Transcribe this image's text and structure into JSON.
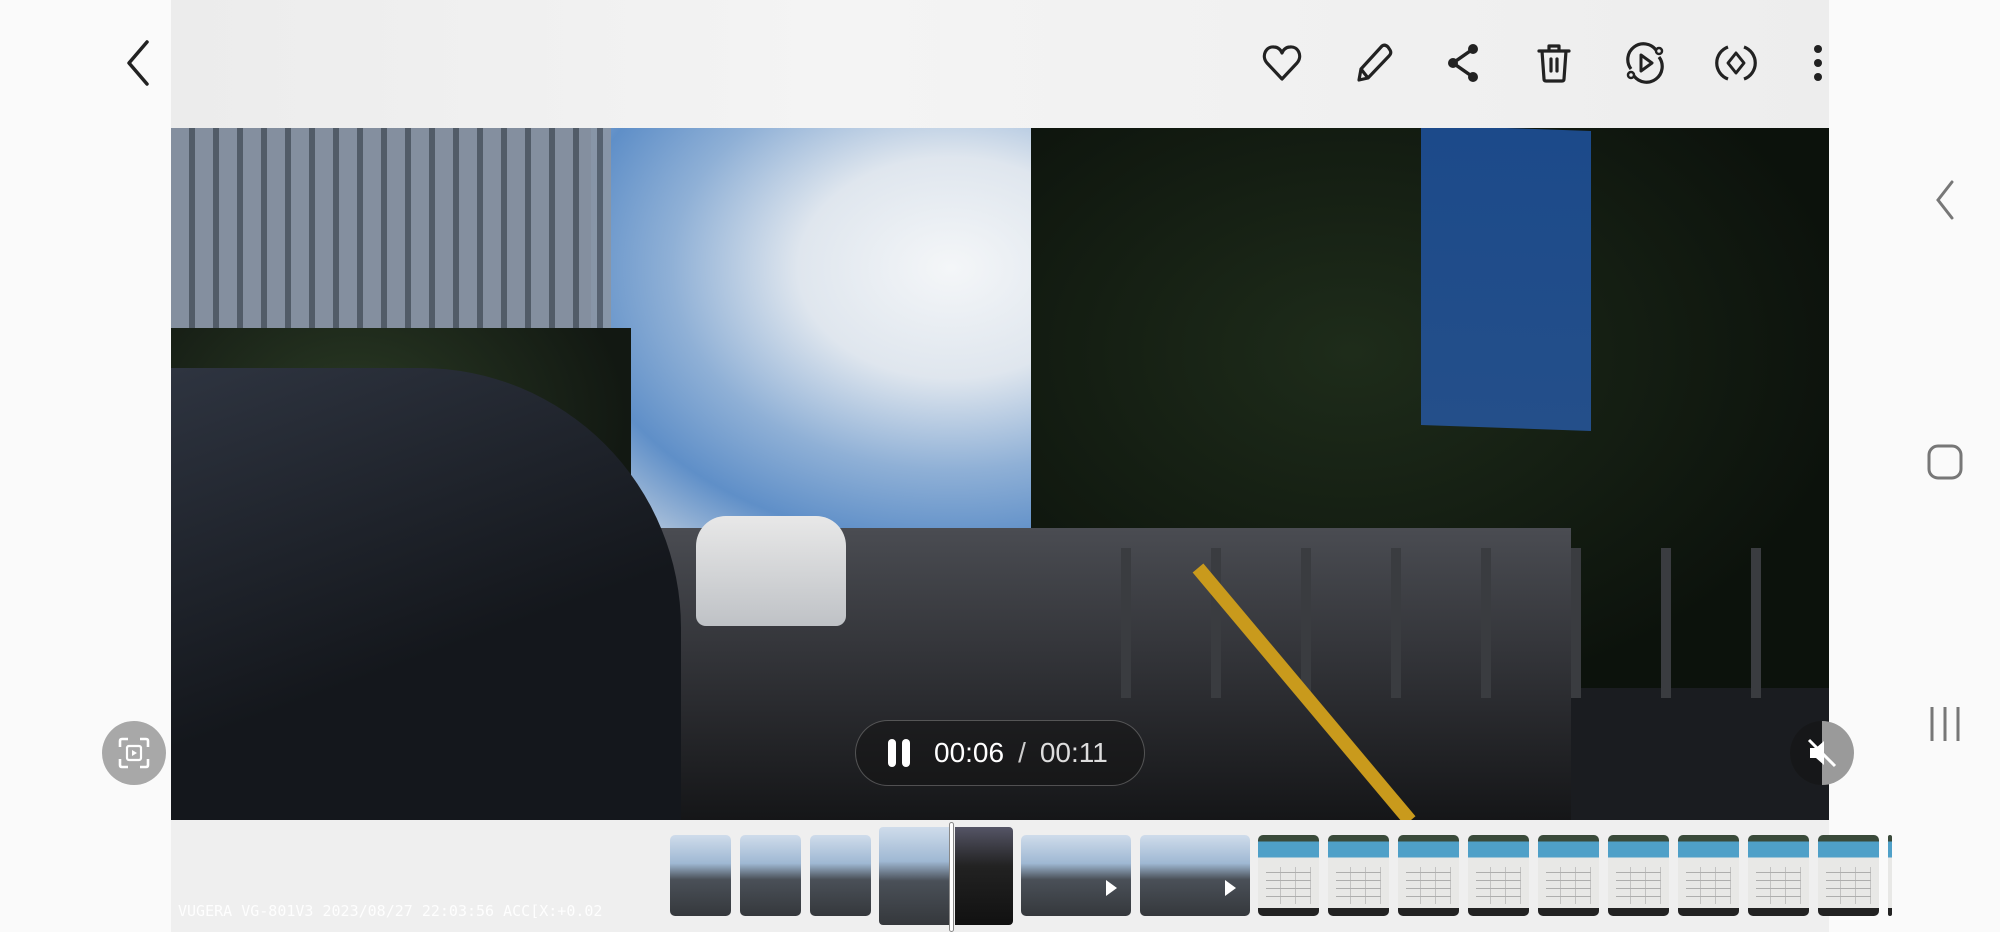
{
  "toolbar": {
    "back": "back-icon",
    "actions": [
      "favorite",
      "edit",
      "share",
      "delete",
      "loop-video",
      "rotate",
      "more-options"
    ]
  },
  "player": {
    "current_time": "00:06",
    "separator": "/",
    "total_time": "00:11",
    "state": "playing",
    "muted": true
  },
  "overlay_text": "VUGERA VG-801V3 2023/08/27 22:03:56 ACC[X:+0.02",
  "filmstrip": {
    "current_index": 4,
    "items": [
      "video",
      "video",
      "video",
      "video",
      "video",
      "video",
      "video",
      "image",
      "image",
      "image",
      "image",
      "image",
      "image",
      "image",
      "image",
      "image",
      "image"
    ]
  },
  "nav": [
    "back",
    "home",
    "recents"
  ]
}
